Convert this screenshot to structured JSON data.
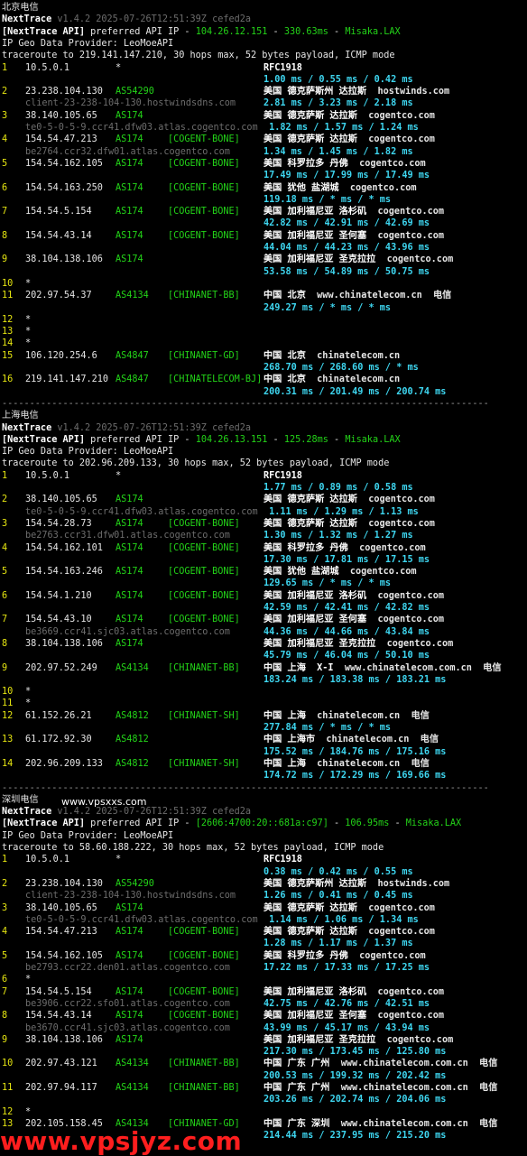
{
  "sections": [
    {
      "title": "北京电信",
      "nt": "NextTrace",
      "ver": "v1.4.2 2025-07-26T12:51:39Z cefed2a",
      "api_prefix": "[NextTrace API]",
      "api_mid": " preferred API IP - ",
      "api_ip": "104.26.12.151",
      "api_sep": " - ",
      "api_ms": "330.63ms",
      "api_sep2": " - ",
      "api_loc": "Misaka.LAX",
      "geo": "IP Geo Data Provider: LeoMoeAPI",
      "trace": "traceroute to 219.141.147.210, 30 hops max, 52 bytes payload, ICMP mode",
      "hops": [
        {
          "n": "1",
          "ip": "10.5.0.1",
          "asn": "*",
          "tag": "",
          "geo": "RFC1918",
          "domain": "",
          "host": "",
          "rtt": "1.00 ms / 0.55 ms / 0.42 ms"
        },
        {
          "n": "2",
          "ip": "23.238.104.130",
          "asn": "AS54290",
          "tag": "",
          "geo": "美国 德克萨斯州 达拉斯",
          "domain": "hostwinds.com",
          "host": "client-23-238-104-130.hostwindsdns.com",
          "rtt": "2.81 ms / 3.23 ms / 2.18 ms"
        },
        {
          "n": "3",
          "ip": "38.140.105.65",
          "asn": "AS174",
          "tag": "",
          "geo": "美国 德克萨斯 达拉斯",
          "domain": "cogentco.com",
          "host": "te0-5-0-5-9.ccr41.dfw03.atlas.cogentco.com",
          "rtt": " 1.82 ms / 1.57 ms / 1.24 ms"
        },
        {
          "n": "4",
          "ip": "154.54.47.213",
          "asn": "AS174",
          "tag": "[COGENT-BONE]",
          "geo": "美国 德克萨斯 达拉斯",
          "domain": "cogentco.com",
          "host": "be2764.ccr32.dfw01.atlas.cogentco.com",
          "rtt": "1.34 ms / 1.45 ms / 1.82 ms"
        },
        {
          "n": "5",
          "ip": "154.54.162.105",
          "asn": "AS174",
          "tag": "[COGENT-BONE]",
          "geo": "美国 科罗拉多 丹佛",
          "domain": "cogentco.com",
          "host": "",
          "rtt": "17.49 ms / 17.99 ms / 17.49 ms"
        },
        {
          "n": "6",
          "ip": "154.54.163.250",
          "asn": "AS174",
          "tag": "[COGENT-BONE]",
          "geo": "美国 犹他 盐湖城",
          "domain": "cogentco.com",
          "host": "",
          "rtt": "119.18 ms / * ms / * ms"
        },
        {
          "n": "7",
          "ip": "154.54.5.154",
          "asn": "AS174",
          "tag": "[COGENT-BONE]",
          "geo": "美国 加利福尼亚 洛杉矶",
          "domain": "cogentco.com",
          "host": "",
          "rtt": "42.82 ms / 42.91 ms / 42.69 ms"
        },
        {
          "n": "8",
          "ip": "154.54.43.14",
          "asn": "AS174",
          "tag": "[COGENT-BONE]",
          "geo": "美国 加利福尼亚 圣何塞",
          "domain": "cogentco.com",
          "host": "",
          "rtt": "44.04 ms / 44.23 ms / 43.96 ms"
        },
        {
          "n": "9",
          "ip": "38.104.138.106",
          "asn": "AS174",
          "tag": "",
          "geo": "美国 加利福尼亚 圣克拉拉",
          "domain": "cogentco.com",
          "host": "",
          "rtt": "53.58 ms / 54.89 ms / 50.75 ms"
        },
        {
          "n": "10",
          "ip": "*",
          "asn": "",
          "tag": "",
          "geo": "",
          "domain": "",
          "host": "",
          "rtt": ""
        },
        {
          "n": "11",
          "ip": "202.97.54.37",
          "asn": "AS4134",
          "tag": "[CHINANET-BB]",
          "geo": "中国 北京",
          "domain": "www.chinatelecom.cn  电信",
          "host": "",
          "rtt": "249.27 ms / * ms / * ms"
        },
        {
          "n": "12",
          "ip": "*",
          "asn": "",
          "tag": "",
          "geo": "",
          "domain": "",
          "host": "",
          "rtt": ""
        },
        {
          "n": "13",
          "ip": "*",
          "asn": "",
          "tag": "",
          "geo": "",
          "domain": "",
          "host": "",
          "rtt": ""
        },
        {
          "n": "14",
          "ip": "*",
          "asn": "",
          "tag": "",
          "geo": "",
          "domain": "",
          "host": "",
          "rtt": ""
        },
        {
          "n": "15",
          "ip": "106.120.254.6",
          "asn": "AS4847",
          "tag": "[CHINANET-GD]",
          "geo": "中国 北京",
          "domain": "chinatelecom.cn",
          "host": "",
          "rtt": "268.70 ms / 268.60 ms / * ms"
        },
        {
          "n": "16",
          "ip": "219.141.147.210",
          "asn": "AS4847",
          "tag": "[CHINATELECOM-BJ]",
          "geo": "中国 北京",
          "domain": "chinatelecom.cn",
          "host": "",
          "rtt": "200.31 ms / 201.49 ms / 200.74 ms"
        }
      ]
    },
    {
      "title": "上海电信",
      "nt": "NextTrace",
      "ver": "v1.4.2 2025-07-26T12:51:39Z cefed2a",
      "api_prefix": "[NextTrace API]",
      "api_mid": " preferred API IP - ",
      "api_ip": "104.26.13.151",
      "api_sep": " - ",
      "api_ms": "125.28ms",
      "api_sep2": " - ",
      "api_loc": "Misaka.LAX",
      "geo": "IP Geo Data Provider: LeoMoeAPI",
      "trace": "traceroute to 202.96.209.133, 30 hops max, 52 bytes payload, ICMP mode",
      "hops": [
        {
          "n": "1",
          "ip": "10.5.0.1",
          "asn": "*",
          "tag": "",
          "geo": "RFC1918",
          "domain": "",
          "host": "",
          "rtt": "1.77 ms / 0.89 ms / 0.58 ms"
        },
        {
          "n": "2",
          "ip": "38.140.105.65",
          "asn": "AS174",
          "tag": "",
          "geo": "美国 德克萨斯 达拉斯",
          "domain": "cogentco.com",
          "host": "te0-5-0-5-9.ccr41.dfw03.atlas.cogentco.com",
          "rtt": " 1.11 ms / 1.29 ms / 1.13 ms"
        },
        {
          "n": "3",
          "ip": "154.54.28.73",
          "asn": "AS174",
          "tag": "[COGENT-BONE]",
          "geo": "美国 德克萨斯 达拉斯",
          "domain": "cogentco.com",
          "host": "be2763.ccr31.dfw01.atlas.cogentco.com",
          "rtt": "1.30 ms / 1.32 ms / 1.27 ms"
        },
        {
          "n": "4",
          "ip": "154.54.162.101",
          "asn": "AS174",
          "tag": "[COGENT-BONE]",
          "geo": "美国 科罗拉多 丹佛",
          "domain": "cogentco.com",
          "host": "",
          "rtt": "17.30 ms / 17.81 ms / 17.15 ms"
        },
        {
          "n": "5",
          "ip": "154.54.163.246",
          "asn": "AS174",
          "tag": "[COGENT-BONE]",
          "geo": "美国 犹他 盐湖城",
          "domain": "cogentco.com",
          "host": "",
          "rtt": "129.65 ms / * ms / * ms"
        },
        {
          "n": "6",
          "ip": "154.54.1.210",
          "asn": "AS174",
          "tag": "[COGENT-BONE]",
          "geo": "美国 加利福尼亚 洛杉矶",
          "domain": "cogentco.com",
          "host": "",
          "rtt": "42.59 ms / 42.41 ms / 42.82 ms"
        },
        {
          "n": "7",
          "ip": "154.54.43.10",
          "asn": "AS174",
          "tag": "[COGENT-BONE]",
          "geo": "美国 加利福尼亚 圣何塞",
          "domain": "cogentco.com",
          "host": "be3669.ccr41.sjc03.atlas.cogentco.com",
          "rtt": "44.36 ms / 44.66 ms / 43.84 ms"
        },
        {
          "n": "8",
          "ip": "38.104.138.106",
          "asn": "AS174",
          "tag": "",
          "geo": "美国 加利福尼亚 圣克拉拉",
          "domain": "cogentco.com",
          "host": "",
          "rtt": "45.79 ms / 46.04 ms / 50.10 ms"
        },
        {
          "n": "9",
          "ip": "202.97.52.249",
          "asn": "AS4134",
          "tag": "[CHINANET-BB]",
          "geo": "中国 上海  X-I",
          "domain": "www.chinatelecom.com.cn  电信",
          "host": "",
          "rtt": "183.24 ms / 183.38 ms / 183.21 ms"
        },
        {
          "n": "10",
          "ip": "*",
          "asn": "",
          "tag": "",
          "geo": "",
          "domain": "",
          "host": "",
          "rtt": ""
        },
        {
          "n": "11",
          "ip": "*",
          "asn": "",
          "tag": "",
          "geo": "",
          "domain": "",
          "host": "",
          "rtt": ""
        },
        {
          "n": "12",
          "ip": "61.152.26.21",
          "asn": "AS4812",
          "tag": "[CHINANET-SH]",
          "geo": "中国 上海",
          "domain": "chinatelecom.cn  电信",
          "host": "",
          "rtt": "277.84 ms / * ms / * ms"
        },
        {
          "n": "13",
          "ip": "61.172.92.30",
          "asn": "AS4812",
          "tag": "",
          "geo": "中国 上海市",
          "domain": "chinatelecom.cn  电信",
          "host": "",
          "rtt": "175.52 ms / 184.76 ms / 175.16 ms"
        },
        {
          "n": "14",
          "ip": "202.96.209.133",
          "asn": "AS4812",
          "tag": "[CHINANET-SH]",
          "geo": "中国 上海",
          "domain": "chinatelecom.cn  电信",
          "host": "",
          "rtt": "174.72 ms / 172.29 ms / 169.66 ms"
        }
      ]
    },
    {
      "title": "深圳电信",
      "nt": "NextTrace",
      "ver": "v1.4.2 2025-07-26T12:51:39Z cefed2a",
      "api_prefix": "[NextTrace API]",
      "api_mid": " preferred API IP - ",
      "api_ip": "[2606:4700:20::681a:c97]",
      "api_sep": " - ",
      "api_ms": "106.95ms",
      "api_sep2": " - ",
      "api_loc": "Misaka.LAX",
      "geo": "IP Geo Data Provider: LeoMoeAPI",
      "trace": "traceroute to 58.60.188.222, 30 hops max, 52 bytes payload, ICMP mode",
      "hops": [
        {
          "n": "1",
          "ip": "10.5.0.1",
          "asn": "*",
          "tag": "",
          "geo": "RFC1918",
          "domain": "",
          "host": "",
          "rtt": "0.38 ms / 0.42 ms / 0.55 ms"
        },
        {
          "n": "2",
          "ip": "23.238.104.130",
          "asn": "AS54290",
          "tag": "",
          "geo": "美国 德克萨斯州 达拉斯",
          "domain": "hostwinds.com",
          "host": "client-23-238-104-130.hostwindsdns.com",
          "rtt": "1.26 ms / 0.41 ms / 0.45 ms"
        },
        {
          "n": "3",
          "ip": "38.140.105.65",
          "asn": "AS174",
          "tag": "",
          "geo": "美国 德克萨斯 达拉斯",
          "domain": "cogentco.com",
          "host": "te0-5-0-5-9.ccr41.dfw03.atlas.cogentco.com",
          "rtt": " 1.14 ms / 1.06 ms / 1.34 ms"
        },
        {
          "n": "4",
          "ip": "154.54.47.213",
          "asn": "AS174",
          "tag": "[COGENT-BONE]",
          "geo": "美国 德克萨斯 达拉斯",
          "domain": "cogentco.com",
          "host": "",
          "rtt": "1.28 ms / 1.17 ms / 1.37 ms"
        },
        {
          "n": "5",
          "ip": "154.54.162.105",
          "asn": "AS174",
          "tag": "[COGENT-BONE]",
          "geo": "美国 科罗拉多 丹佛",
          "domain": "cogentco.com",
          "host": "be2793.ccr22.den01.atlas.cogentco.com",
          "rtt": "17.22 ms / 17.33 ms / 17.25 ms"
        },
        {
          "n": "6",
          "ip": "*",
          "asn": "",
          "tag": "",
          "geo": "",
          "domain": "",
          "host": "",
          "rtt": ""
        },
        {
          "n": "7",
          "ip": "154.54.5.154",
          "asn": "AS174",
          "tag": "[COGENT-BONE]",
          "geo": "美国 加利福尼亚 洛杉矶",
          "domain": "cogentco.com",
          "host": "be3906.ccr22.sfo01.atlas.cogentco.com",
          "rtt": "42.75 ms / 42.76 ms / 42.51 ms"
        },
        {
          "n": "8",
          "ip": "154.54.43.14",
          "asn": "AS174",
          "tag": "[COGENT-BONE]",
          "geo": "美国 加利福尼亚 圣何塞",
          "domain": "cogentco.com",
          "host": "be3670.ccr41.sjc03.atlas.cogentco.com",
          "rtt": "43.99 ms / 45.17 ms / 43.94 ms"
        },
        {
          "n": "9",
          "ip": "38.104.138.106",
          "asn": "AS174",
          "tag": "",
          "geo": "美国 加利福尼亚 圣克拉拉",
          "domain": "cogentco.com",
          "host": "",
          "rtt": "217.30 ms / 173.45 ms / 125.80 ms"
        },
        {
          "n": "10",
          "ip": "202.97.43.121",
          "asn": "AS4134",
          "tag": "[CHINANET-BB]",
          "geo": "中国 广东 广州",
          "domain": "www.chinatelecom.com.cn  电信",
          "host": "",
          "rtt": "200.53 ms / 199.32 ms / 202.42 ms"
        },
        {
          "n": "11",
          "ip": "202.97.94.117",
          "asn": "AS4134",
          "tag": "[CHINANET-BB]",
          "geo": "中国 广东 广州",
          "domain": "www.chinatelecom.com.cn  电信",
          "host": "",
          "rtt": "203.26 ms / 202.74 ms / 204.06 ms"
        },
        {
          "n": "12",
          "ip": "*",
          "asn": "",
          "tag": "",
          "geo": "",
          "domain": "",
          "host": "",
          "rtt": ""
        },
        {
          "n": "13",
          "ip": "202.105.158.45",
          "asn": "AS4134",
          "tag": "[CHINANET-GD]",
          "geo": "中国 广东 深圳",
          "domain": "www.chinatelecom.com.cn  电信",
          "host": "",
          "rtt": "214.44 ms / 237.95 ms / 215.20 ms"
        }
      ]
    }
  ],
  "separator": "----------------------------------------------------------------------------------------",
  "site_label": "www.vpsxxs.com",
  "watermark": "www.vpsjyz.com",
  "colors": {
    "background": "#000000",
    "asn": "#23d318",
    "hop": "#e5e511",
    "rtt": "#3ed6f0",
    "host": "#6d6d6d",
    "watermark": "#ff1e1e"
  }
}
